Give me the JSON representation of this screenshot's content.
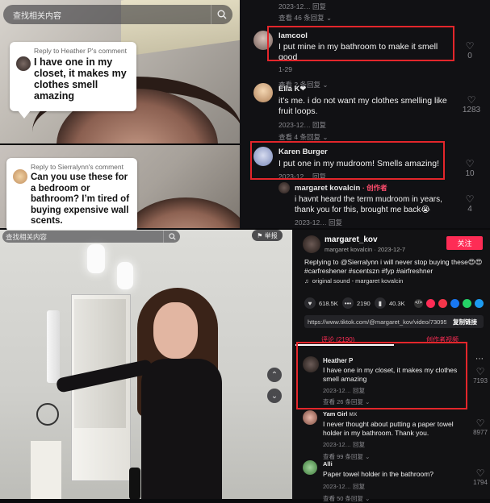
{
  "search": {
    "placeholder_top": "查找相关内容",
    "placeholder_bottom": "查找相关内容"
  },
  "video1": {
    "reply_label": "Reply to Heather P's comment",
    "text": "I have one in my closet, it makes my clothes smell amazing"
  },
  "video2": {
    "reply_label": "Reply to Sierralynn's comment",
    "text": "Can you use these for a bedroom or bathroom? I’m tired of buying expensive wall scents."
  },
  "comments_top": {
    "header_meta": "2023-12… 回复",
    "header_more": "查看 46 条回复",
    "items": [
      {
        "name": "Iamcool",
        "text": "I put mine in my bathroom to make it smell good",
        "meta": "1-29",
        "more": "查看 2 条回复",
        "likes": "0"
      },
      {
        "name": "Ella K❤",
        "text": "it’s me. i do not want my clothes smelling like fruit loops.",
        "meta": "2023-12… 回复",
        "more": "查看 4 条回复",
        "likes": "1283"
      },
      {
        "name": "Karen Burger",
        "text": "I put one in my mudroom! Smells amazing!",
        "meta": "2023-12… 回复",
        "more": "",
        "likes": "10"
      },
      {
        "name": "margaret kovalcin",
        "tag": "· 创作者",
        "text": "i havnt heard the term mudroom in years, thank you for this, brought me back😭",
        "meta": "2023-12… 回复",
        "more": "",
        "likes": "4"
      }
    ]
  },
  "video3": {
    "report_label": "举报",
    "up_icon": "chevron-up-icon",
    "down_icon": "chevron-down-icon"
  },
  "post": {
    "username": "margaret_kov",
    "subline": "margaret kovalcin · 2023-12-7",
    "follow_label": "关注",
    "caption": "Replying to @Sierralynn i will never stop buying these😍😍 #carfreshener #scentszn #fyp #airfreshner",
    "sound": "original sound - margaret kovalcin",
    "stats": {
      "likes": "618.5K",
      "comments": "2190",
      "saves": "40.3K"
    },
    "url": "https://www.tiktok.com/@margaret_kov/video/730958…",
    "copy_label": "复制链接",
    "tab_comments": "评论 (2190)",
    "tab_creator": "创作者视频"
  },
  "comments_bottom": [
    {
      "name": "Heather P",
      "text": "I have one in my closet, it makes my clothes smell amazing",
      "meta": "2023-12… 回复",
      "more": "查看 26 条回复",
      "likes": "7193"
    },
    {
      "name": "Yam Girl",
      "badge": "MX",
      "text": "I never thought about putting a paper towel holder in my bathroom. Thank you.",
      "meta": "2023-12… 回复",
      "more": "查看 99 条回复",
      "likes": "8977"
    },
    {
      "name": "Alli",
      "text": "Paper towel holder in the bathroom?",
      "meta": "2023-12… 回复",
      "more": "查看 50 条回复",
      "likes": "1794"
    }
  ],
  "colors": {
    "accent": "#fe2c55",
    "highlight_box": "#e3262b",
    "panel_bg": "#121214"
  }
}
